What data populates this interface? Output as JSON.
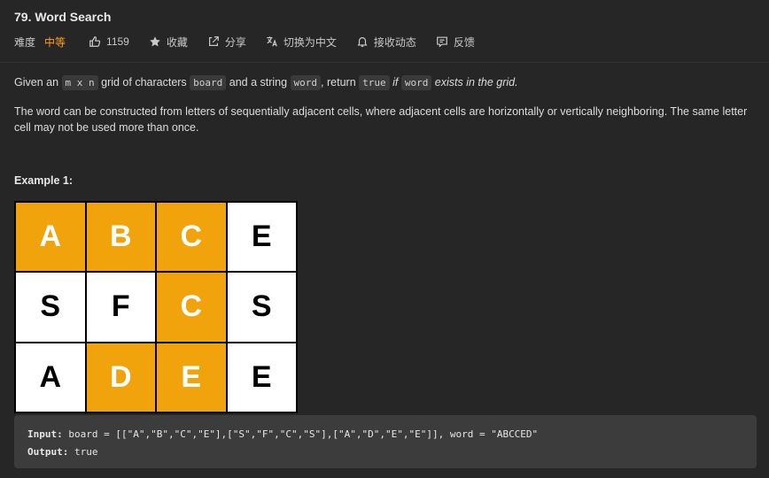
{
  "problem": {
    "title": "79. Word Search",
    "difficulty_label": "难度",
    "difficulty": "中等",
    "likes": "1159",
    "favorite": "收藏",
    "share": "分享",
    "switch_lang": "切换为中文",
    "follow": "接收动态",
    "feedback": "反馈"
  },
  "description": {
    "p1": {
      "t1": "Given an ",
      "c1": "m x n",
      "t2": " grid of characters ",
      "c2": "board",
      "t3": " and a string ",
      "c3": "word",
      "t4": ", return ",
      "c4": "true",
      "t5": " if ",
      "c5": "word",
      "t6": " exists in the grid."
    },
    "p2": "The word can be constructed from letters of sequentially adjacent cells, where adjacent cells are horizontally or vertically neighboring. The same letter cell may not be used more than once."
  },
  "example": {
    "title": "Example 1:",
    "grid": [
      [
        "A",
        "B",
        "C",
        "E"
      ],
      [
        "S",
        "F",
        "C",
        "S"
      ],
      [
        "A",
        "D",
        "E",
        "E"
      ]
    ],
    "highlight_color": "#f0a30a",
    "input_label": "Input:",
    "input_value": " board = [[\"A\",\"B\",\"C\",\"E\"],[\"S\",\"F\",\"C\",\"S\"],[\"A\",\"D\",\"E\",\"E\"]], word = \"ABCCED\"",
    "output_label": "Output:",
    "output_value": " true"
  }
}
